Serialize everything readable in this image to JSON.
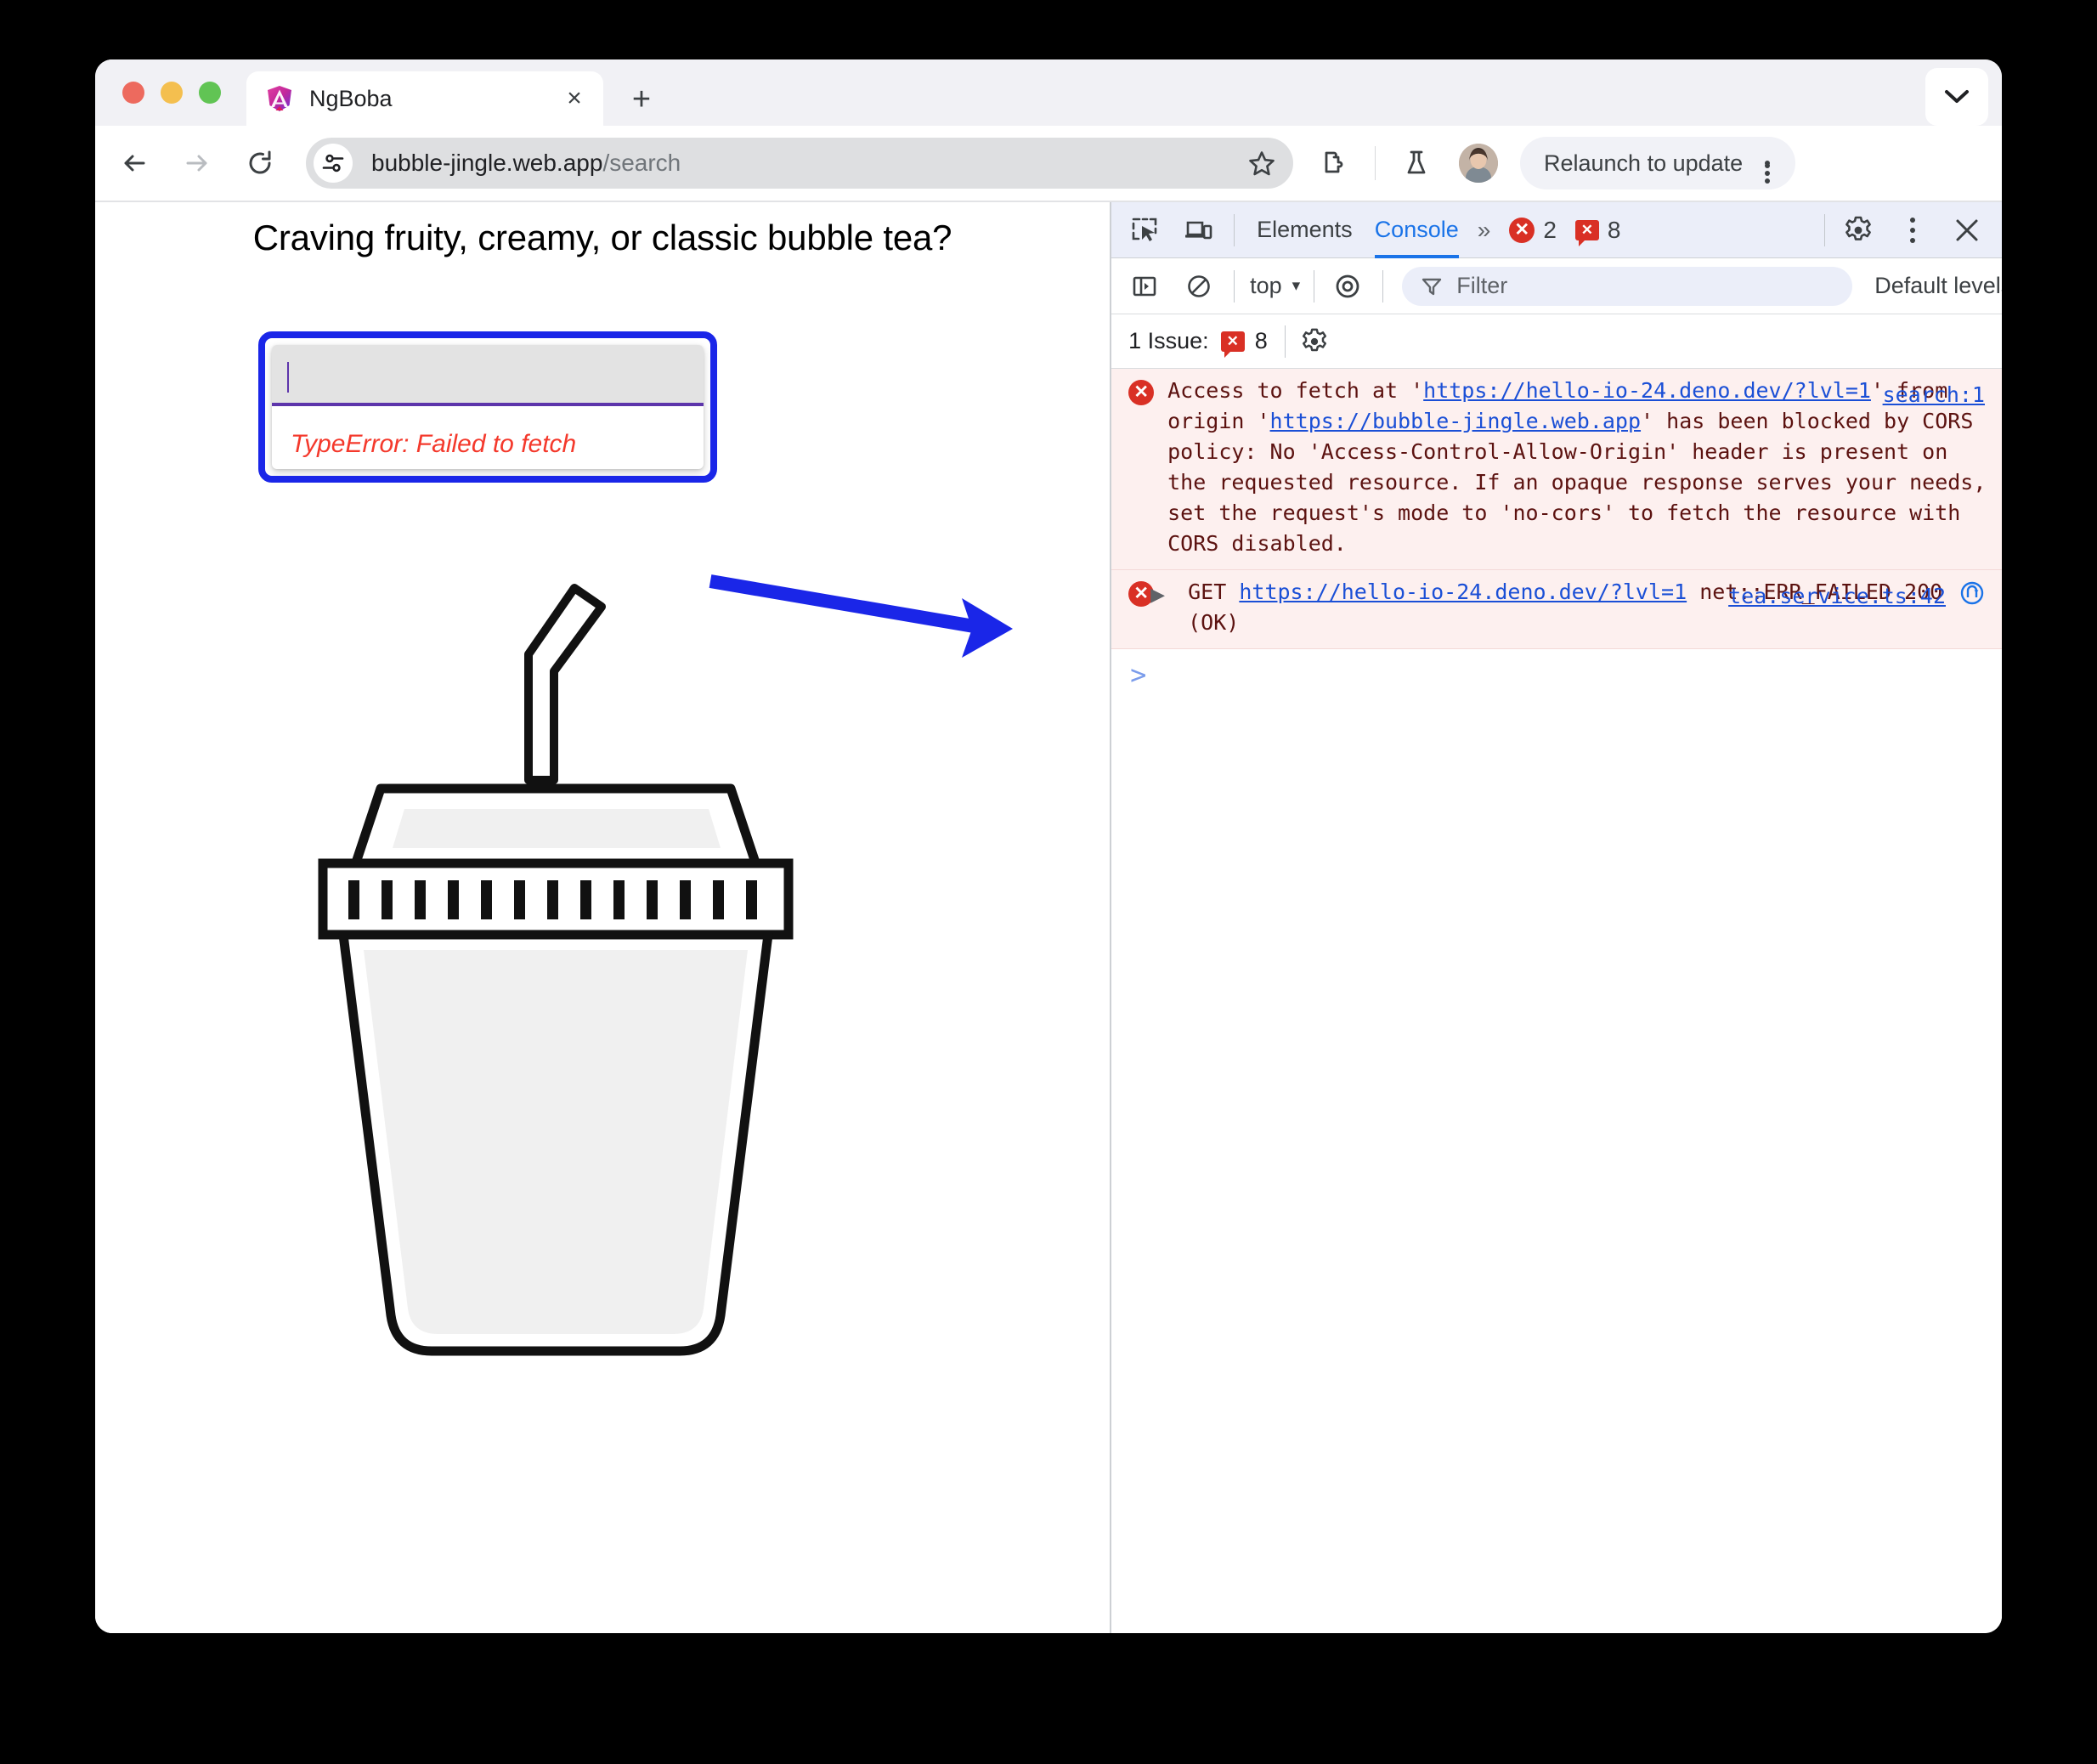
{
  "window": {
    "traffic_lights": [
      "close",
      "minimize",
      "maximize"
    ]
  },
  "tabstrip": {
    "tab_title": "NgBoba",
    "favicon": "angular-logo-icon",
    "close_label": "×",
    "newtab_label": "+",
    "expand_icon": "chevron-down-icon"
  },
  "toolbar": {
    "back_icon": "arrow-left-icon",
    "forward_icon": "arrow-right-icon",
    "reload_icon": "reload-icon",
    "site_settings_icon": "tune-sliders-icon",
    "url_host": "bubble-jingle.web.app",
    "url_path": "/search",
    "url_full": "bubble-jingle.web.app/search",
    "star_icon": "star-outline-icon",
    "extensions_icon": "extensions-puzzle-icon",
    "labs_icon": "flask-beaker-icon",
    "avatar_name": "profile-avatar",
    "relaunch_label": "Relaunch to update",
    "menu_icon": "kebab-menu-icon"
  },
  "page": {
    "heading": "Craving fruity, creamy, or classic bubble tea?",
    "search_input_value": "",
    "search_input_placeholder": "",
    "error_message": "TypeError: Failed to fetch",
    "illustration": "boba-cup-illustration",
    "annotation": "blue-arrow-annotation",
    "colors": {
      "highlight_border": "#1a26e8",
      "input_fill": "#e3e3e3",
      "input_underline": "#5d35ab",
      "error_text": "#f4392c"
    }
  },
  "devtools": {
    "header": {
      "inspect_icon": "inspect-element-icon",
      "device_icon": "device-toolbar-icon",
      "tabs": [
        {
          "label": "Elements",
          "active": false
        },
        {
          "label": "Console",
          "active": true
        }
      ],
      "more_tabs_icon": "»",
      "error_count": "2",
      "error_icon": "error-circle-icon",
      "issue_count": "8",
      "issue_icon": "issue-bubble-icon",
      "settings_icon": "gear-icon",
      "more_options_icon": "kebab-menu-icon",
      "close_icon": "close-icon"
    },
    "subbar": {
      "sidebar_icon": "console-sidebar-icon",
      "clear_icon": "clear-console-icon",
      "context": "top",
      "context_caret": "▾",
      "live_expression_icon": "eye-icon",
      "filter_icon": "filter-funnel-icon",
      "filter_placeholder": "Filter",
      "filter_value": "",
      "levels_label": "Default levels",
      "levels_caret": "▾"
    },
    "issues_bar": {
      "label": "1 Issue:",
      "count": "8",
      "icon": "issue-bubble-icon",
      "settings_icon": "gear-icon"
    },
    "messages": [
      {
        "icon": "error-circle-icon",
        "source": "search:1",
        "has_disclosure": false,
        "has_jump_icon": false,
        "segments": [
          {
            "text": "Access to fetch at '",
            "link": false
          },
          {
            "text": "https://hello-io-24.deno.dev/?lvl=1",
            "link": true
          },
          {
            "text": "' from origin '",
            "link": false
          },
          {
            "text": "https://bubble-jingle.web.app",
            "link": true
          },
          {
            "text": "' has been blocked by CORS policy: No 'Access-Control-Allow-Origin' header is present on the requested resource. If an opaque response serves your needs, set the request's mode to 'no-cors' to fetch the resource with CORS disabled.",
            "link": false
          }
        ]
      },
      {
        "icon": "error-circle-icon",
        "source": "tea.service.ts:42",
        "has_disclosure": true,
        "disclosure_icon": "▶",
        "has_jump_icon": true,
        "jump_icon": "jump-to-source-icon",
        "segments": [
          {
            "text": "GET ",
            "link": false
          },
          {
            "text": "https://hello-io-24.deno.dev/?lvl=1",
            "link": true
          },
          {
            "text": " net::ERR_FAILED 200 (OK)",
            "link": false
          }
        ]
      }
    ],
    "prompt_symbol": ">"
  }
}
